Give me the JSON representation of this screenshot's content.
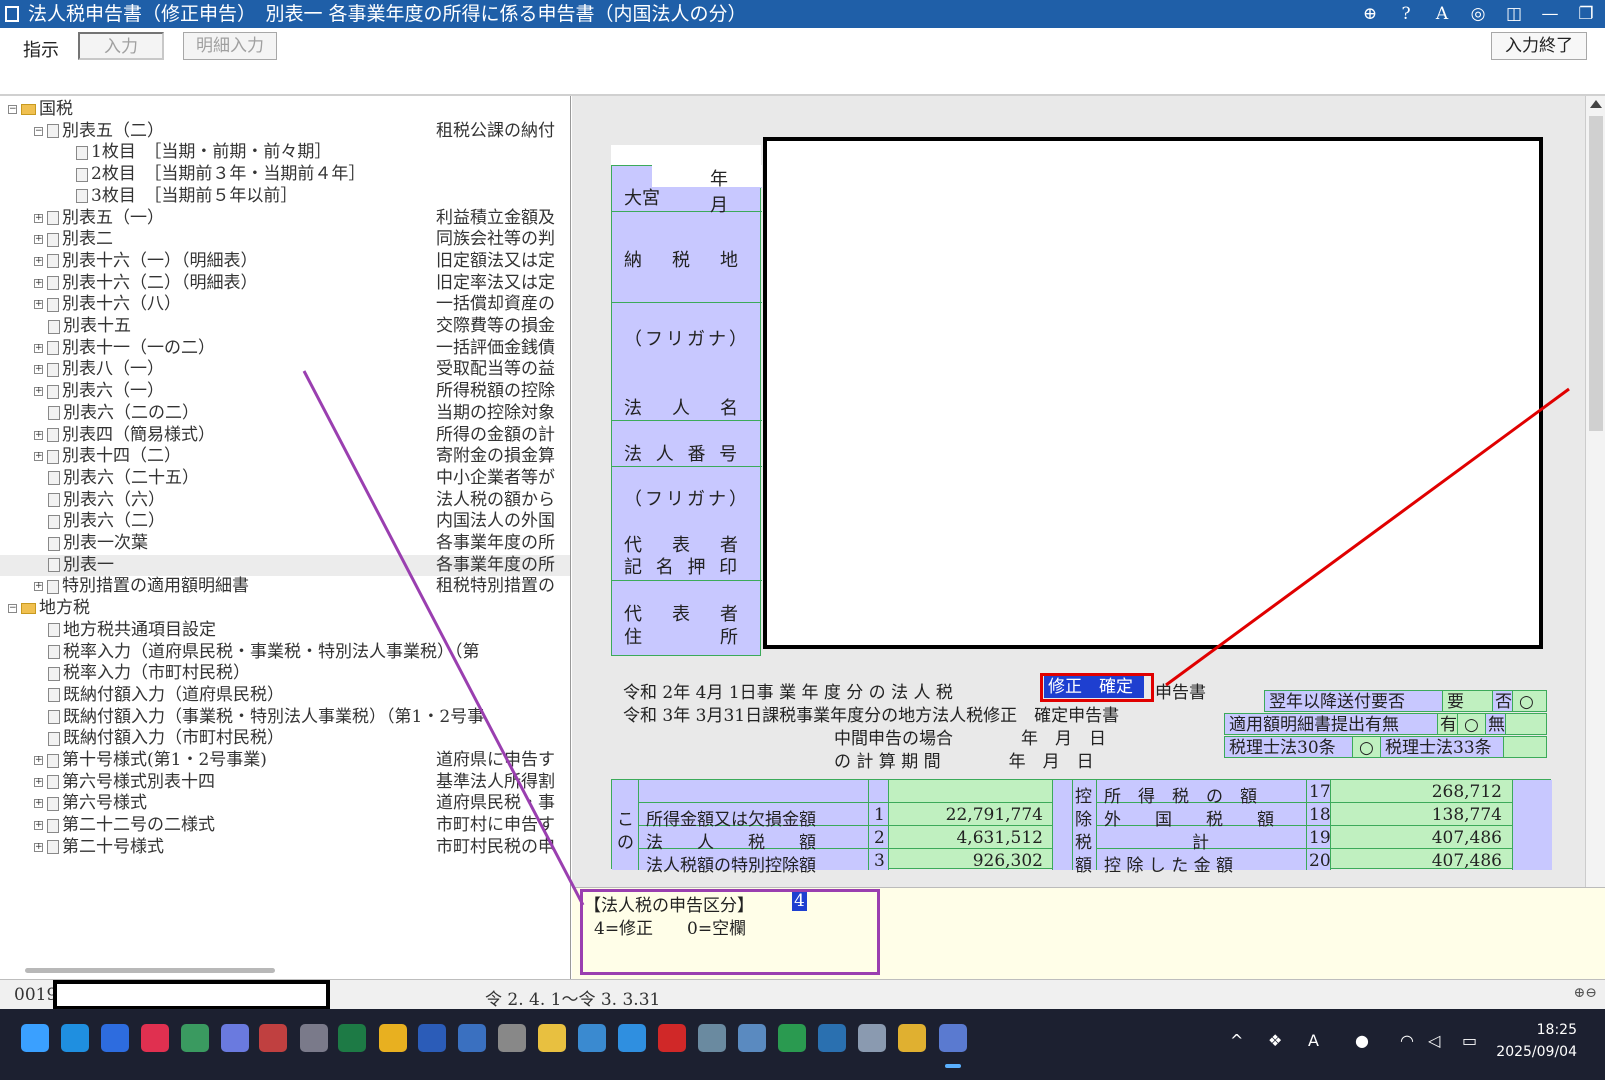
{
  "window": {
    "title": "法人税申告書（修正申告）　別表一 各事業年度の所得に係る申告書（内国法人の分）"
  },
  "toolbar": {
    "label": "指示",
    "input_btn": "入力",
    "detail_btn": "明細入力",
    "end_btn": "入力終了"
  },
  "tree": {
    "items": [
      {
        "name": "国税",
        "desc": ""
      },
      {
        "name": "別表五（二）",
        "desc": "租税公課の納付"
      },
      {
        "name": "1枚目　［当期・前期・前々期］",
        "desc": ""
      },
      {
        "name": "2枚目　［当期前３年・当期前４年］",
        "desc": ""
      },
      {
        "name": "3枚目　［当期前５年以前］",
        "desc": ""
      },
      {
        "name": "別表五（一）",
        "desc": "利益積立金額及"
      },
      {
        "name": "別表二",
        "desc": "同族会社等の判"
      },
      {
        "name": "別表十六（一）（明細表）",
        "desc": "旧定額法又は定"
      },
      {
        "name": "別表十六（二）（明細表）",
        "desc": "旧定率法又は定"
      },
      {
        "name": "別表十六（八）",
        "desc": "一括償却資産の"
      },
      {
        "name": "別表十五",
        "desc": "交際費等の損金"
      },
      {
        "name": "別表十一（一の二）",
        "desc": "一括評価金銭債"
      },
      {
        "name": "別表八（一）",
        "desc": "受取配当等の益"
      },
      {
        "name": "別表六（一）",
        "desc": "所得税額の控除"
      },
      {
        "name": "別表六（二の二）",
        "desc": "当期の控除対象"
      },
      {
        "name": "別表四（簡易様式）",
        "desc": "所得の金額の計"
      },
      {
        "name": "別表十四（二）",
        "desc": "寄附金の損金算"
      },
      {
        "name": "別表六（二十五）",
        "desc": "中小企業者等が"
      },
      {
        "name": "別表六（六）",
        "desc": "法人税の額から"
      },
      {
        "name": "別表六（二）",
        "desc": "内国法人の外国"
      },
      {
        "name": "別表一次葉",
        "desc": "各事業年度の所"
      },
      {
        "name": "別表一",
        "desc": "各事業年度の所"
      },
      {
        "name": "特別措置の適用額明細書",
        "desc": "租税特別措置の"
      },
      {
        "name": "地方税",
        "desc": ""
      },
      {
        "name": "地方税共通項目設定",
        "desc": ""
      },
      {
        "name": "税率入力（道府県民税・事業税・特別法人事業税）（第",
        "desc": ""
      },
      {
        "name": "税率入力（市町村民税）",
        "desc": ""
      },
      {
        "name": "既納付額入力（道府県民税）",
        "desc": ""
      },
      {
        "name": "既納付額入力（事業税・特別法人事業税）（第1・2号事",
        "desc": ""
      },
      {
        "name": "既納付額入力（市町村民税）",
        "desc": ""
      },
      {
        "name": "第十号様式(第1・2号事業)",
        "desc": "道府県に申告す"
      },
      {
        "name": "第六号様式別表十四",
        "desc": "基準法人所得割"
      },
      {
        "name": "第六号様式",
        "desc": "道府県民税・事"
      },
      {
        "name": "第二十二号の二様式",
        "desc": "市町村に申告す"
      },
      {
        "name": "第二十号様式",
        "desc": "市町村民税の申"
      }
    ]
  },
  "status": {
    "code": "0019",
    "period": "令 2. 4. 1～令 3. 3.31"
  },
  "form": {
    "year_month": "年　月",
    "office": "大宮",
    "labels": {
      "nouzeichi": "納　税　地",
      "furigana1": "（フリガナ）",
      "houjinmei": "法　人　名",
      "houjinbangou": "法 人 番 号",
      "furigana2": "（フリガナ）",
      "daihyosha": "代　表　者",
      "kimei": "記 名 押 印",
      "daihyosha2": "代　表　者",
      "jusho": "住　　　所"
    },
    "line1_pre": "令和 2年 4月 1日事 業 年 度 分 の 法 人 税",
    "line1_hl": "修正　確定",
    "line1_post": "申告書",
    "line2": "令和 3年 3月31日課税事業年度分の地方法人税修正　確定申告書",
    "line3": "中間申告の場合　　　　年　月　日",
    "line4": "の 計 算 期 間　　　　年　月　日",
    "tags": {
      "yokunen": "翌年以降送付要否",
      "yo": "要",
      "hi": "否",
      "tekiyou": "適用額明細書提出有無",
      "u": "有",
      "mu": "無",
      "zeirishi30": "税理士法30条",
      "zeirishi33": "税理士法33条",
      "circle": "○"
    },
    "table": {
      "left_side": [
        "こ",
        "の"
      ],
      "rows": [
        {
          "label": "所得金額又は欠損金額",
          "no": "1",
          "value": "22,791,774"
        },
        {
          "label": "法　　人　　税　　額",
          "no": "2",
          "value": "4,631,512"
        },
        {
          "label": "法人税額の特別控除額",
          "no": "3",
          "value": "926,302"
        }
      ],
      "right_side": [
        "控",
        "除",
        "税",
        "額"
      ],
      "right_rows": [
        {
          "label": "所　得　税　の　額",
          "no": "17",
          "value": "268,712"
        },
        {
          "label": "外　　国　　税　　額",
          "no": "18",
          "value": "138,774"
        },
        {
          "label": "計",
          "no": "19",
          "value": "407,486"
        },
        {
          "label": "控 除 し た 金 額",
          "no": "20",
          "value": "407,486"
        }
      ]
    }
  },
  "tooltip": {
    "title": "【法人税の申告区分】",
    "value": "4",
    "options": "4=修正　　0=空欄"
  },
  "taskbar": {
    "time": "18:25",
    "date": "2025/09/04",
    "ime": "A"
  },
  "colors": {
    "titlebar": "#1f5fa8",
    "label_cell": "#c8c8ff",
    "value_cell": "#c0f0c0",
    "highlight": "#1e3fd0",
    "annotation_red": "#e00000",
    "annotation_purple": "#9a3fb0"
  }
}
